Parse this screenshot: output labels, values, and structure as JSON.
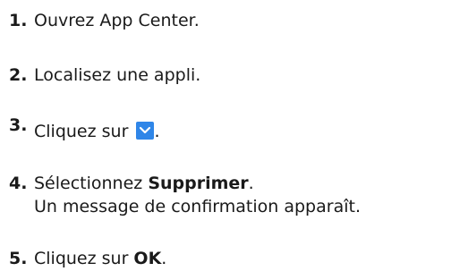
{
  "steps": [
    {
      "num": "1.",
      "text": "Ouvrez App Center."
    },
    {
      "num": "2.",
      "text": "Localisez une appli."
    },
    {
      "num": "3.",
      "text_before": "Cliquez sur",
      "text_after": ".",
      "icon": "chevron-down-icon"
    },
    {
      "num": "4.",
      "text_before": "Sélectionnez ",
      "bold": "Supprimer",
      "text_after": ".",
      "line2": "Un message de confirmation apparaît."
    },
    {
      "num": "5.",
      "text_before": "Cliquez sur ",
      "bold": "OK",
      "text_after": "."
    }
  ],
  "colors": {
    "icon_bg": "#2f86e8",
    "icon_fg": "#ffffff",
    "text": "#1a1a1a"
  }
}
